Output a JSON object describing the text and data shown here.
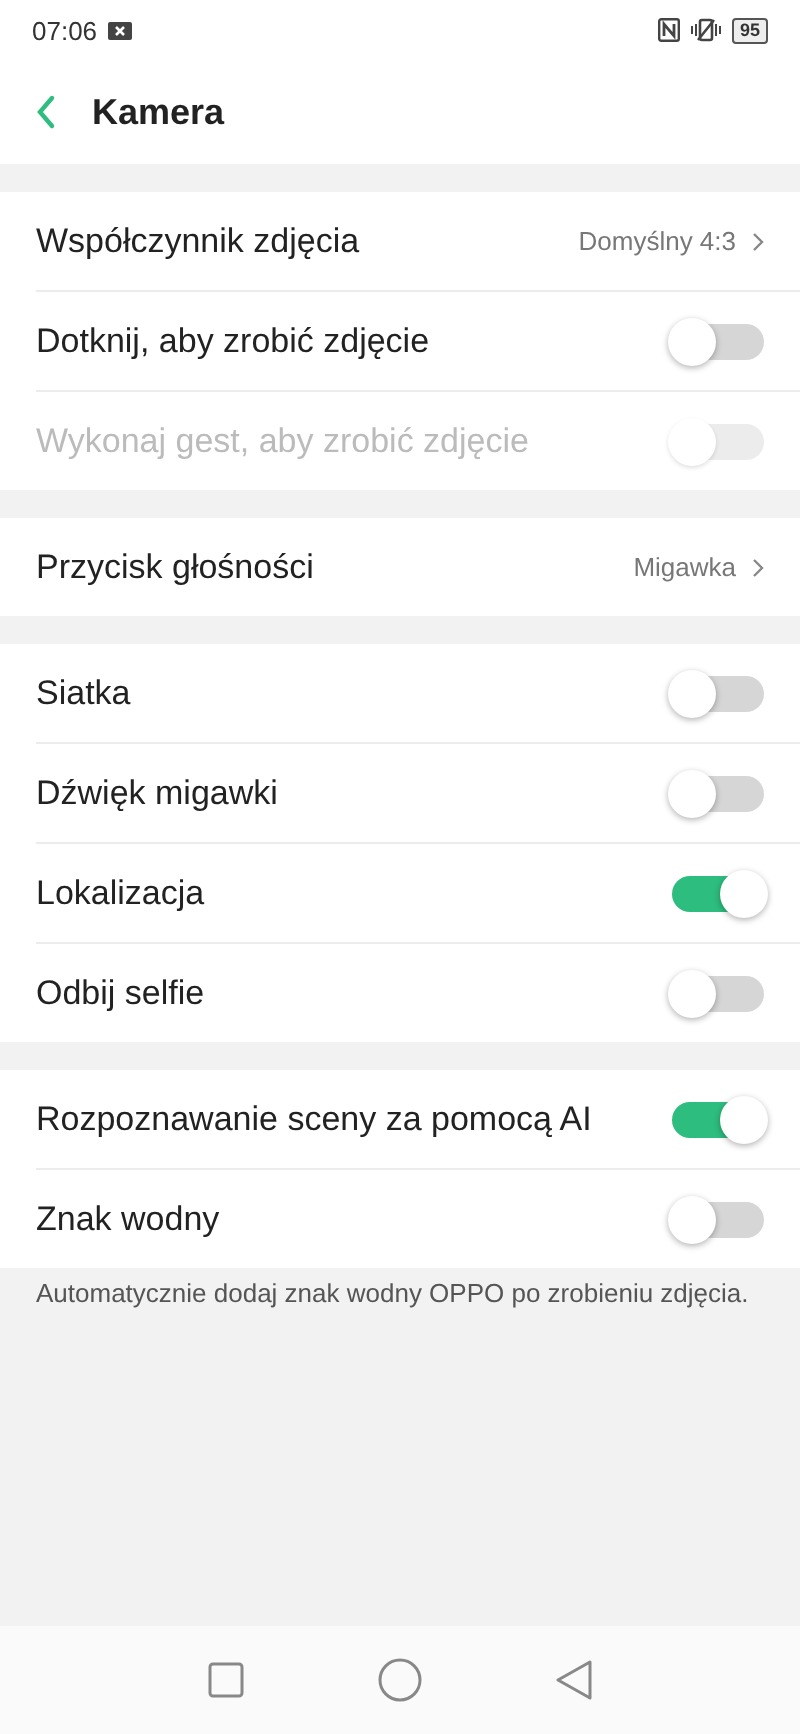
{
  "status_bar": {
    "time": "07:06",
    "battery": "95"
  },
  "header": {
    "title": "Kamera"
  },
  "sections": [
    {
      "rows": [
        {
          "kind": "link",
          "label": "Współczynnik zdjęcia",
          "value": "Domyślny 4:3"
        },
        {
          "kind": "switch",
          "label": "Dotknij, aby zrobić zdjęcie",
          "on": false,
          "disabled": false
        },
        {
          "kind": "switch",
          "label": "Wykonaj gest, aby zrobić zdjęcie",
          "on": false,
          "disabled": true
        }
      ]
    },
    {
      "rows": [
        {
          "kind": "link",
          "label": "Przycisk głośności",
          "value": "Migawka"
        }
      ]
    },
    {
      "rows": [
        {
          "kind": "switch",
          "label": "Siatka",
          "on": false,
          "disabled": false
        },
        {
          "kind": "switch",
          "label": "Dźwięk migawki",
          "on": false,
          "disabled": false
        },
        {
          "kind": "switch",
          "label": "Lokalizacja",
          "on": true,
          "disabled": false
        },
        {
          "kind": "switch",
          "label": "Odbij selfie",
          "on": false,
          "disabled": false
        }
      ]
    },
    {
      "rows": [
        {
          "kind": "switch",
          "label": "Rozpoznawanie sceny za pomocą AI",
          "on": true,
          "disabled": false
        },
        {
          "kind": "switch",
          "label": "Znak wodny",
          "on": false,
          "disabled": false
        }
      ],
      "note": "Automatycznie dodaj znak wodny OPPO po zrobieniu zdjęcia."
    }
  ]
}
